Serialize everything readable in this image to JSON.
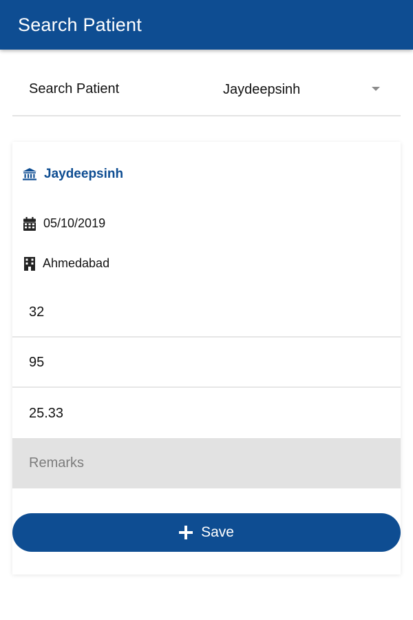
{
  "app_bar": {
    "title": "Search Patient"
  },
  "search": {
    "label": "Search Patient",
    "selected_value": "Jaydeepsinh"
  },
  "patient": {
    "name": "Jaydeepsinh",
    "name_icon": "bank-icon",
    "date": "05/10/2019",
    "date_icon": "calendar-icon",
    "city": "Ahmedabad",
    "city_icon": "building-icon"
  },
  "fields": {
    "field1_value": "32",
    "field2_value": "95",
    "field3_value": "25.33",
    "remarks_placeholder": "Remarks",
    "remarks_value": ""
  },
  "actions": {
    "save_label": "Save",
    "save_icon": "plus-icon"
  },
  "colors": {
    "primary": "#0e4d92",
    "field_bg": "#e2e2e2",
    "placeholder": "#7c7c7c"
  }
}
